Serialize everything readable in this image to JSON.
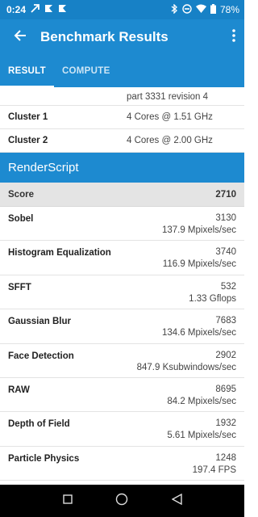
{
  "status_bar": {
    "time": "0:24",
    "battery": "78%",
    "icons": [
      "notification-arrow-icon",
      "notification-flag-icon",
      "notification-flag-icon",
      "bluetooth-icon",
      "do-not-disturb-icon",
      "wifi-icon",
      "battery-icon"
    ]
  },
  "app_bar": {
    "title": "Benchmark Results"
  },
  "tabs": [
    {
      "label": "RESULT",
      "active": true
    },
    {
      "label": "COMPUTE",
      "active": false
    }
  ],
  "system_info": [
    {
      "label": "",
      "value": "part 3331 revision 4"
    },
    {
      "label": "Cluster 1",
      "value": "4 Cores @ 1.51 GHz"
    },
    {
      "label": "Cluster 2",
      "value": "4 Cores @ 2.00 GHz"
    }
  ],
  "section": {
    "title": "RenderScript",
    "score_label": "Score",
    "score_value": "2710"
  },
  "benchmarks": [
    {
      "name": "Sobel",
      "score": "3130",
      "rate": "137.9 Mpixels/sec"
    },
    {
      "name": "Histogram Equalization",
      "score": "3740",
      "rate": "116.9 Mpixels/sec"
    },
    {
      "name": "SFFT",
      "score": "532",
      "rate": "1.33 Gflops"
    },
    {
      "name": "Gaussian Blur",
      "score": "7683",
      "rate": "134.6 Mpixels/sec"
    },
    {
      "name": "Face Detection",
      "score": "2902",
      "rate": "847.9 Ksubwindows/sec"
    },
    {
      "name": "RAW",
      "score": "8695",
      "rate": "84.2 Mpixels/sec"
    },
    {
      "name": "Depth of Field",
      "score": "1932",
      "rate": "5.61 Mpixels/sec"
    },
    {
      "name": "Particle Physics",
      "score": "1248",
      "rate": "197.4 FPS"
    }
  ],
  "colors": {
    "primary": "#1d8ad0",
    "status_bar": "#1781c6",
    "score_row": "#e4e4e4",
    "nav_bar": "#000000"
  }
}
